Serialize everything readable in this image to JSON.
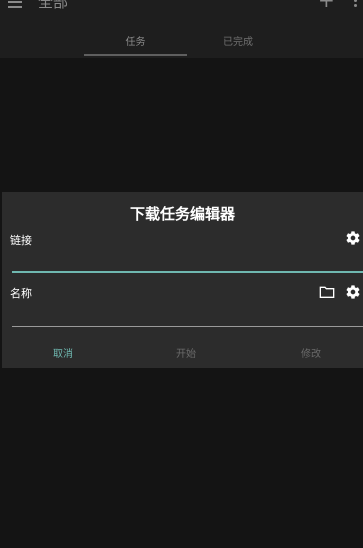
{
  "appbar": {
    "title": "全部",
    "tabs": [
      {
        "label": "任务"
      },
      {
        "label": "已完成"
      }
    ]
  },
  "dialog": {
    "title": "下载任务编辑器",
    "link_label": "链接",
    "link_value": "",
    "name_label": "名称",
    "name_value": "",
    "actions": {
      "cancel": "取消",
      "start": "开始",
      "edit": "修改"
    }
  },
  "colors": {
    "accent": "#6fb8b0",
    "background": "#141414",
    "dialog": "#2c2c2c"
  },
  "icons": [
    "menu-icon",
    "plus-icon",
    "more-icon",
    "settings-gear-icon",
    "folder-icon"
  ]
}
